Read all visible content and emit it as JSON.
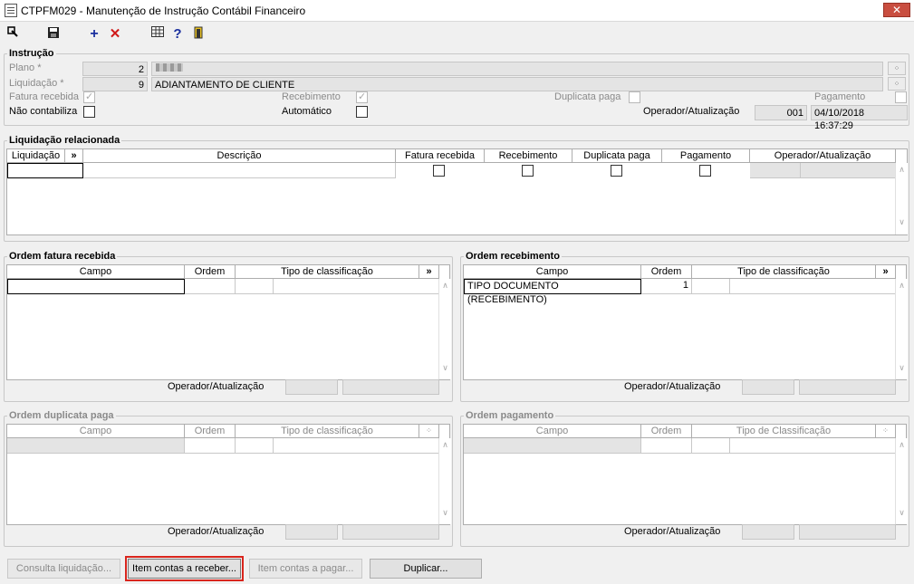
{
  "window": {
    "title": "CTPFM029 - Manutenção de Instrução Contábil Financeiro",
    "close": "✕"
  },
  "toolbar": {
    "icons": [
      "export-icon",
      "save-icon",
      "add-icon",
      "delete-icon",
      "grid-icon",
      "help-icon",
      "exit-icon"
    ]
  },
  "instrucao": {
    "title": "Instrução",
    "plano_label": "Plano *",
    "plano_value": "2",
    "liquidacao_label": "Liquidação *",
    "liquidacao_value": "9",
    "liquidacao_desc": "ADIANTAMENTO DE CLIENTE",
    "fatura_recebida_label": "Fatura recebida",
    "recebimento_label": "Recebimento",
    "duplicata_paga_label": "Duplicata paga",
    "pagamento_label": "Pagamento",
    "nao_contabiliza_label": "Não contabiliza",
    "automatico_label": "Automático",
    "operador_label": "Operador/Atualização",
    "operador_value": "001",
    "atualizacao_value": "04/10/2018 16:37:29"
  },
  "liq_rel": {
    "title": "Liquidação relacionada",
    "headers": [
      "Liquidação",
      "»",
      "Descrição",
      "Fatura recebida",
      "Recebimento",
      "Duplicata paga",
      "Pagamento",
      "Operador/Atualização"
    ]
  },
  "ofr": {
    "title": "Ordem fatura recebida",
    "headers": [
      "Campo",
      "Ordem",
      "Tipo de classificação",
      "»"
    ],
    "operador_label": "Operador/Atualização"
  },
  "orec": {
    "title": "Ordem recebimento",
    "headers": [
      "Campo",
      "Ordem",
      "Tipo de classificação",
      "»"
    ],
    "row": {
      "campo": "TIPO DOCUMENTO (RECEBIMENTO)",
      "ordem": "1"
    },
    "operador_label": "Operador/Atualização"
  },
  "odp": {
    "title": "Ordem duplicata paga",
    "headers": [
      "Campo",
      "Ordem",
      "Tipo de classificação"
    ],
    "operador_label": "Operador/Atualização"
  },
  "opag": {
    "title": "Ordem pagamento",
    "headers": [
      "Campo",
      "Ordem",
      "Tipo de Classificação"
    ],
    "operador_label": "Operador/Atualização"
  },
  "buttons": {
    "consulta": "Consulta liquidação...",
    "item_receber": "Item contas a receber...",
    "item_pagar": "Item contas a pagar...",
    "duplicar": "Duplicar..."
  }
}
